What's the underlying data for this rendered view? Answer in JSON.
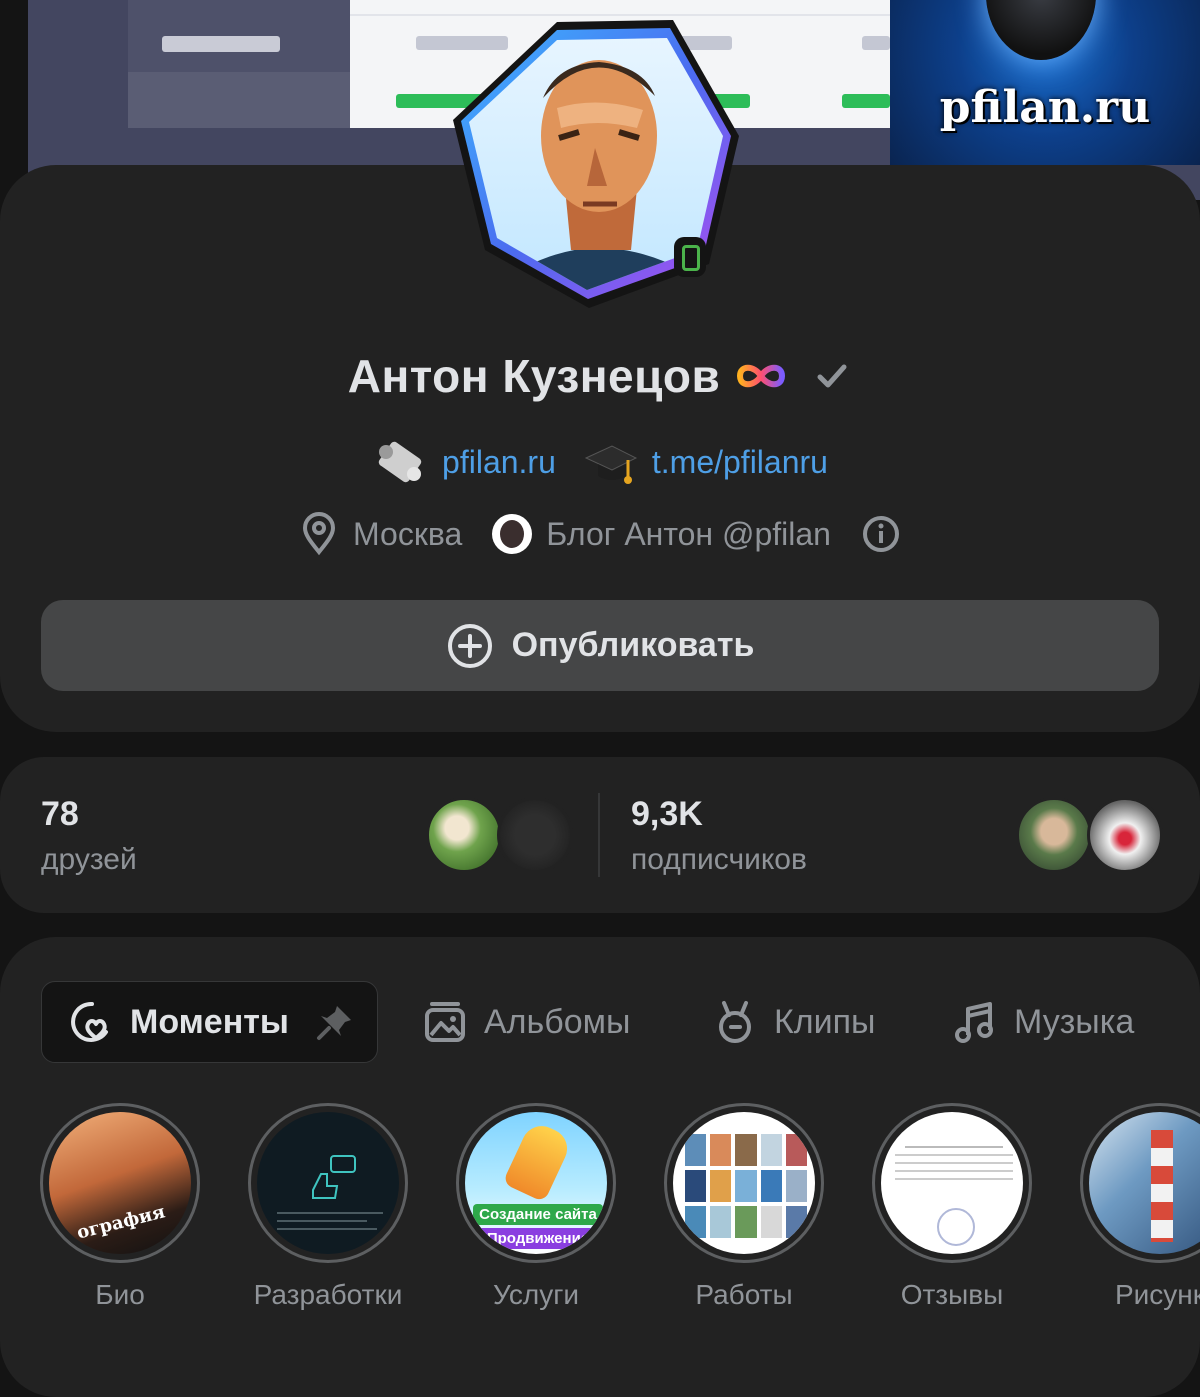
{
  "cover": {
    "brand_text": "pfilan.ru"
  },
  "profile": {
    "name": "Антон Кузнецов",
    "links": [
      {
        "icon": "scroll-icon",
        "text": "pfilan.ru"
      },
      {
        "icon": "graduation-cap-icon",
        "text": "t.me/pfilanru"
      }
    ],
    "location": "Москва",
    "community": "Блог Антон @pfilan",
    "publish_label": "Опубликовать"
  },
  "stats": {
    "friends_count": "78",
    "friends_label": "друзей",
    "followers_count": "9,3K",
    "followers_label": "подписчиков"
  },
  "tabs": [
    {
      "label": "Моменты",
      "icon": "moments-icon",
      "active": true
    },
    {
      "label": "Альбомы",
      "icon": "album-icon"
    },
    {
      "label": "Клипы",
      "icon": "clips-icon"
    },
    {
      "label": "Музыка",
      "icon": "music-icon"
    }
  ],
  "stories": [
    {
      "label": "Био",
      "overlay": "ография"
    },
    {
      "label": "Разработки"
    },
    {
      "label": "Услуги",
      "overlay": "Создание сайта",
      "overlay2": "Продвижение"
    },
    {
      "label": "Работы"
    },
    {
      "label": "Отзывы"
    },
    {
      "label": "Рисунк"
    }
  ],
  "colors": {
    "background": "#141414",
    "card": "#222222",
    "link": "#4e9fe6",
    "online": "#4bb34b",
    "muted_text": "#909499"
  }
}
